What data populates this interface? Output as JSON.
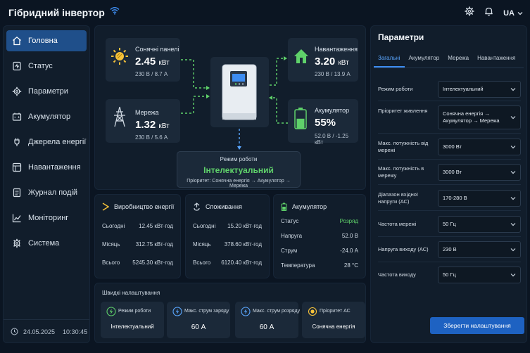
{
  "app": {
    "title": "Гібридний інвертор",
    "language": "UA",
    "datetime": {
      "date": "24.05.2025",
      "time": "10:30:45"
    }
  },
  "nav": {
    "items": [
      {
        "label": "Головна",
        "icon": "home-icon",
        "active": true
      },
      {
        "label": "Статус",
        "icon": "status-icon"
      },
      {
        "label": "Параметри",
        "icon": "gear-icon"
      },
      {
        "label": "Акумулятор",
        "icon": "battery-icon"
      },
      {
        "label": "Джерела енергії",
        "icon": "plug-icon"
      },
      {
        "label": "Навантаження",
        "icon": "load-icon"
      },
      {
        "label": "Журнал подій",
        "icon": "log-icon"
      },
      {
        "label": "Моніторинг",
        "icon": "chart-icon"
      },
      {
        "label": "Система",
        "icon": "system-gear-icon"
      }
    ]
  },
  "flow": {
    "solar": {
      "label": "Сонячні панелі",
      "value": "2.45",
      "unit": "кВт",
      "detail": "230 В / 8.7 А"
    },
    "grid": {
      "label": "Мережа",
      "value": "1.32",
      "unit": "кВт",
      "detail": "230 В / 5.6 А"
    },
    "load": {
      "label": "Навантаження",
      "value": "3.20",
      "unit": "кВт",
      "detail": "230 В / 13.9 А"
    },
    "battery": {
      "label": "Акумулятор",
      "value": "55%",
      "detail": "52.0 В / -1.25 кВт",
      "level": 0.55
    },
    "mode": {
      "label": "Режим роботи",
      "value": "Інтелектуальний",
      "priority": "Пріоритет: Сонячна енергія → Акумулятор → Мережа"
    }
  },
  "stats": {
    "production": {
      "title": "Виробництво енергії",
      "rows": [
        {
          "label": "Сьогодні",
          "value": "12.45 кВт·год"
        },
        {
          "label": "Місяць",
          "value": "312.75 кВт·год"
        },
        {
          "label": "Всього",
          "value": "5245.30 кВт·год"
        }
      ]
    },
    "consumption": {
      "title": "Споживання",
      "rows": [
        {
          "label": "Сьогодні",
          "value": "15.20 кВт·год"
        },
        {
          "label": "Місяць",
          "value": "378.60 кВт·год"
        },
        {
          "label": "Всього",
          "value": "6120.40 кВт·год"
        }
      ]
    },
    "battery": {
      "title": "Акумулятор",
      "rows": [
        {
          "label": "Статус",
          "value": "Розряд"
        },
        {
          "label": "Напруга",
          "value": "52.0 В"
        },
        {
          "label": "Струм",
          "value": "-24.0 А"
        },
        {
          "label": "Температура",
          "value": "28 °C"
        }
      ]
    }
  },
  "quick": {
    "title": "Швидкі налаштування",
    "items": [
      {
        "label": "Режим роботи",
        "value": "Інтелектуальний"
      },
      {
        "label": "Макс. струм заряду",
        "value": "60 А"
      },
      {
        "label": "Макс. струм розряду",
        "value": "60 А"
      },
      {
        "label": "Пріоритет АС",
        "value": "Сонячна енергія"
      }
    ]
  },
  "params": {
    "title": "Параметри",
    "tabs": [
      "Загальні",
      "Акумулятор",
      "Мережа",
      "Навантаження"
    ],
    "fields": [
      {
        "label": "Режим роботи",
        "value": "Інтелектуальний"
      },
      {
        "label": "Пріоритет живлення",
        "value": "Сонячна енергія → Акумулятор → Мережа"
      },
      {
        "label": "Макс. потужність від мережі",
        "value": "3000 Вт"
      },
      {
        "label": "Макс. потужність в мережу",
        "value": "3000 Вт"
      },
      {
        "label": "Діапазон вхідної напруги (АС)",
        "value": "170-280 В"
      },
      {
        "label": "Частота мережі",
        "value": "50 Гц"
      },
      {
        "label": "Напруга виходу (АС)",
        "value": "230 В"
      },
      {
        "label": "Частота виходу",
        "value": "50 Гц"
      }
    ],
    "save_label": "Зберегти налаштування"
  },
  "colors": {
    "accent": "#1e62c2",
    "green": "#5fd16a",
    "solar": "#f6c23a",
    "background": "#0b1522",
    "panel": "#111d2b"
  }
}
